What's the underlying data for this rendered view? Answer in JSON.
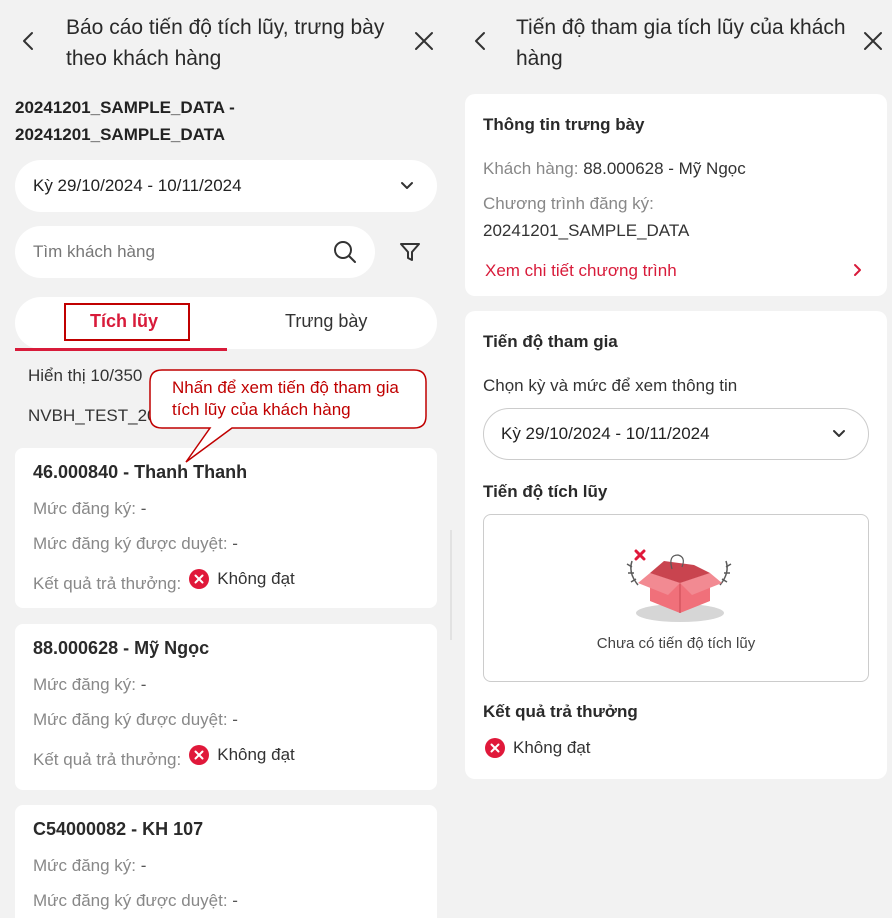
{
  "left": {
    "title": "Báo cáo tiến độ tích lũy, trưng bày theo khách hàng",
    "program": "20241201_SAMPLE_DATA - 20241201_SAMPLE_DATA",
    "period": "Kỳ 29/10/2024 - 10/11/2024",
    "search_placeholder": "Tìm khách hàng",
    "tabs": [
      "Tích lũy",
      "Trưng bày"
    ],
    "showing": "Hiển thị 10/350",
    "staff": "NVBH_TEST_20",
    "callout": "Nhấn để xem tiến độ tham gia tích lũy của khách hàng",
    "labels": {
      "level": "Mức đăng ký:",
      "approved": "Mức đăng ký được duyệt:",
      "result": "Kết quả trả thưởng:"
    },
    "customers": [
      {
        "name": "46.000840 - Thanh Thanh",
        "level": "-",
        "approved": "-",
        "result": "Không đạt"
      },
      {
        "name": "88.000628 - Mỹ Ngọc",
        "level": "-",
        "approved": "-",
        "result": "Không đạt"
      },
      {
        "name": "C54000082 - KH 107",
        "level": "-",
        "approved": "-"
      }
    ]
  },
  "right": {
    "title": "Tiến độ tham gia tích lũy của khách hàng",
    "info_title": "Thông tin trưng bày",
    "customer_label": "Khách hàng:",
    "customer_value": "88.000628 - Mỹ Ngọc",
    "program_label": "Chương trình đăng ký:",
    "program_value": "20241201_SAMPLE_DATA",
    "link": "Xem chi tiết chương trình",
    "progress_title": "Tiến độ tham gia",
    "choose_text": "Chọn kỳ và mức để xem thông tin",
    "period": "Kỳ 29/10/2024 - 10/11/2024",
    "accum_title": "Tiến độ tích lũy",
    "empty_text": "Chưa có tiến độ tích lũy",
    "reward_title": "Kết quả trả thưởng",
    "reward_value": "Không đạt"
  },
  "colors": {
    "accent": "#d81b3a",
    "callout": "#c00000",
    "background": "#f2f2f2"
  }
}
